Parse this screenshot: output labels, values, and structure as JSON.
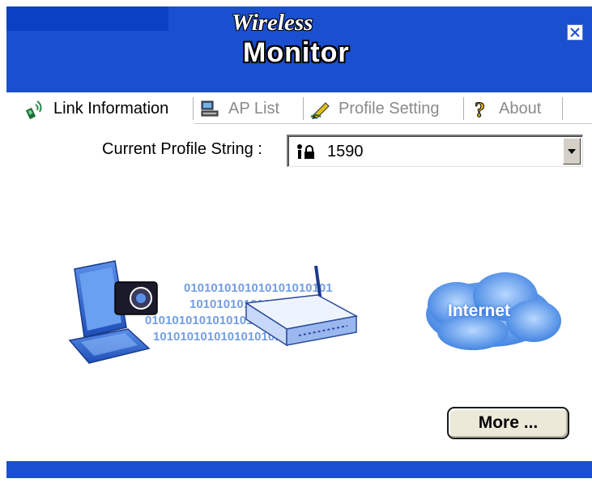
{
  "app": {
    "title_line1": "Wireless",
    "title_line2": "Monitor",
    "accent_color": "#1a4fd0"
  },
  "window": {
    "close_icon": "close-icon"
  },
  "tabs": [
    {
      "label": "Link Information",
      "icon": "wireless-signal-icon",
      "active": true
    },
    {
      "label": "AP List",
      "icon": "computer-network-icon",
      "active": false
    },
    {
      "label": "Profile Setting",
      "icon": "pencil-icon",
      "active": false
    },
    {
      "label": "About",
      "icon": "help-question-icon",
      "active": false
    }
  ],
  "profile": {
    "label": "Current Profile String :",
    "value": "1590",
    "icon": "user-lock-icon"
  },
  "illustration": {
    "laptop_icon": "laptop-icon",
    "router_icon": "router-icon",
    "cloud_label": "Internet",
    "binary_rows": [
      "0101010101010101010101",
      "1010101010101010101",
      "0101010101010101010",
      "1010101010101010101010"
    ]
  },
  "actions": {
    "more_label": "More ..."
  }
}
